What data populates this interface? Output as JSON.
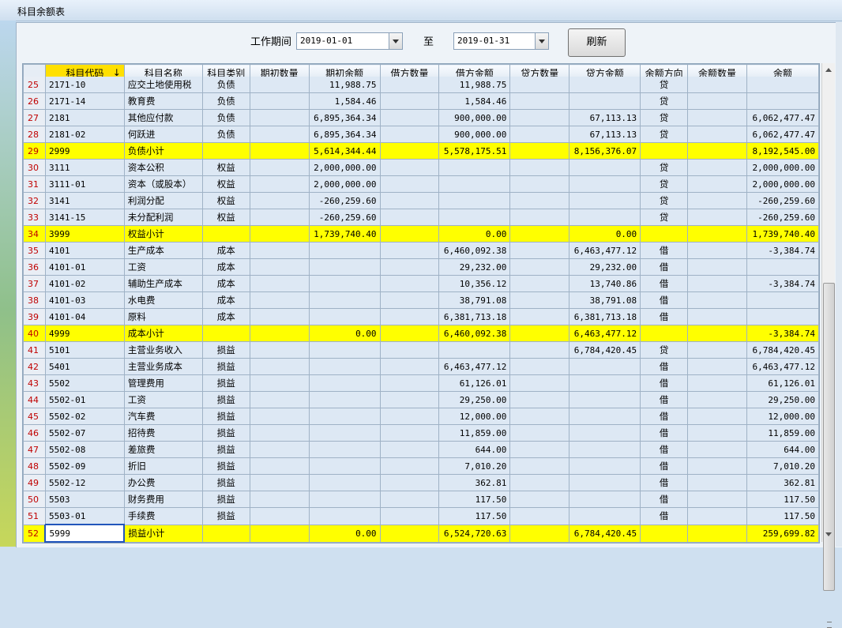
{
  "window": {
    "title": "科目余额表"
  },
  "toolbar": {
    "period_label": "工作期间",
    "start_date": "2019-01-01",
    "to_label": "至",
    "end_date": "2019-01-31",
    "refresh_label": "刷新"
  },
  "table": {
    "headers": [
      "科目代码",
      "科目名称",
      "科目类别",
      "期初数量",
      "期初余额",
      "借方数量",
      "借方金额",
      "贷方数量",
      "贷方金额",
      "余额方向",
      "余额数量",
      "余额"
    ],
    "sort_indicator": "↓",
    "rows": [
      {
        "no": "25",
        "code": "2171-10",
        "name": "应交土地使用税",
        "cat": "负债",
        "oq": "",
        "ob": "11,988.75",
        "dq": "",
        "da": "11,988.75",
        "cq": "",
        "ca": "",
        "dir": "贷",
        "bq": "",
        "bal": "",
        "subtotal": false
      },
      {
        "no": "26",
        "code": "2171-14",
        "name": "教育费",
        "cat": "负债",
        "oq": "",
        "ob": "1,584.46",
        "dq": "",
        "da": "1,584.46",
        "cq": "",
        "ca": "",
        "dir": "贷",
        "bq": "",
        "bal": "",
        "subtotal": false
      },
      {
        "no": "27",
        "code": "2181",
        "name": "其他应付款",
        "cat": "负债",
        "oq": "",
        "ob": "6,895,364.34",
        "dq": "",
        "da": "900,000.00",
        "cq": "",
        "ca": "67,113.13",
        "dir": "贷",
        "bq": "",
        "bal": "6,062,477.47",
        "subtotal": false
      },
      {
        "no": "28",
        "code": "2181-02",
        "name": "何跃进",
        "cat": "负债",
        "oq": "",
        "ob": "6,895,364.34",
        "dq": "",
        "da": "900,000.00",
        "cq": "",
        "ca": "67,113.13",
        "dir": "贷",
        "bq": "",
        "bal": "6,062,477.47",
        "subtotal": false
      },
      {
        "no": "29",
        "code": "2999",
        "name": "负债小计",
        "cat": "",
        "oq": "",
        "ob": "5,614,344.44",
        "dq": "",
        "da": "5,578,175.51",
        "cq": "",
        "ca": "8,156,376.07",
        "dir": "",
        "bq": "",
        "bal": "8,192,545.00",
        "subtotal": true
      },
      {
        "no": "30",
        "code": "3111",
        "name": "资本公积",
        "cat": "权益",
        "oq": "",
        "ob": "2,000,000.00",
        "dq": "",
        "da": "",
        "cq": "",
        "ca": "",
        "dir": "贷",
        "bq": "",
        "bal": "2,000,000.00",
        "subtotal": false
      },
      {
        "no": "31",
        "code": "3111-01",
        "name": "资本（或股本）",
        "cat": "权益",
        "oq": "",
        "ob": "2,000,000.00",
        "dq": "",
        "da": "",
        "cq": "",
        "ca": "",
        "dir": "贷",
        "bq": "",
        "bal": "2,000,000.00",
        "subtotal": false
      },
      {
        "no": "32",
        "code": "3141",
        "name": "利润分配",
        "cat": "权益",
        "oq": "",
        "ob": "-260,259.60",
        "dq": "",
        "da": "",
        "cq": "",
        "ca": "",
        "dir": "贷",
        "bq": "",
        "bal": "-260,259.60",
        "subtotal": false
      },
      {
        "no": "33",
        "code": "3141-15",
        "name": "未分配利润",
        "cat": "权益",
        "oq": "",
        "ob": "-260,259.60",
        "dq": "",
        "da": "",
        "cq": "",
        "ca": "",
        "dir": "贷",
        "bq": "",
        "bal": "-260,259.60",
        "subtotal": false
      },
      {
        "no": "34",
        "code": "3999",
        "name": "权益小计",
        "cat": "",
        "oq": "",
        "ob": "1,739,740.40",
        "dq": "",
        "da": "0.00",
        "cq": "",
        "ca": "0.00",
        "dir": "",
        "bq": "",
        "bal": "1,739,740.40",
        "subtotal": true
      },
      {
        "no": "35",
        "code": "4101",
        "name": "生产成本",
        "cat": "成本",
        "oq": "",
        "ob": "",
        "dq": "",
        "da": "6,460,092.38",
        "cq": "",
        "ca": "6,463,477.12",
        "dir": "借",
        "bq": "",
        "bal": "-3,384.74",
        "subtotal": false
      },
      {
        "no": "36",
        "code": "4101-01",
        "name": "工资",
        "cat": "成本",
        "oq": "",
        "ob": "",
        "dq": "",
        "da": "29,232.00",
        "cq": "",
        "ca": "29,232.00",
        "dir": "借",
        "bq": "",
        "bal": "",
        "subtotal": false
      },
      {
        "no": "37",
        "code": "4101-02",
        "name": "辅助生产成本",
        "cat": "成本",
        "oq": "",
        "ob": "",
        "dq": "",
        "da": "10,356.12",
        "cq": "",
        "ca": "13,740.86",
        "dir": "借",
        "bq": "",
        "bal": "-3,384.74",
        "subtotal": false
      },
      {
        "no": "38",
        "code": "4101-03",
        "name": "水电费",
        "cat": "成本",
        "oq": "",
        "ob": "",
        "dq": "",
        "da": "38,791.08",
        "cq": "",
        "ca": "38,791.08",
        "dir": "借",
        "bq": "",
        "bal": "",
        "subtotal": false
      },
      {
        "no": "39",
        "code": "4101-04",
        "name": "原料",
        "cat": "成本",
        "oq": "",
        "ob": "",
        "dq": "",
        "da": "6,381,713.18",
        "cq": "",
        "ca": "6,381,713.18",
        "dir": "借",
        "bq": "",
        "bal": "",
        "subtotal": false
      },
      {
        "no": "40",
        "code": "4999",
        "name": "成本小计",
        "cat": "",
        "oq": "",
        "ob": "0.00",
        "dq": "",
        "da": "6,460,092.38",
        "cq": "",
        "ca": "6,463,477.12",
        "dir": "",
        "bq": "",
        "bal": "-3,384.74",
        "subtotal": true
      },
      {
        "no": "41",
        "code": "5101",
        "name": "主营业务收入",
        "cat": "损益",
        "oq": "",
        "ob": "",
        "dq": "",
        "da": "",
        "cq": "",
        "ca": "6,784,420.45",
        "dir": "贷",
        "bq": "",
        "bal": "6,784,420.45",
        "subtotal": false
      },
      {
        "no": "42",
        "code": "5401",
        "name": "主营业务成本",
        "cat": "损益",
        "oq": "",
        "ob": "",
        "dq": "",
        "da": "6,463,477.12",
        "cq": "",
        "ca": "",
        "dir": "借",
        "bq": "",
        "bal": "6,463,477.12",
        "subtotal": false
      },
      {
        "no": "43",
        "code": "5502",
        "name": "管理费用",
        "cat": "损益",
        "oq": "",
        "ob": "",
        "dq": "",
        "da": "61,126.01",
        "cq": "",
        "ca": "",
        "dir": "借",
        "bq": "",
        "bal": "61,126.01",
        "subtotal": false
      },
      {
        "no": "44",
        "code": "5502-01",
        "name": "工资",
        "cat": "损益",
        "oq": "",
        "ob": "",
        "dq": "",
        "da": "29,250.00",
        "cq": "",
        "ca": "",
        "dir": "借",
        "bq": "",
        "bal": "29,250.00",
        "subtotal": false
      },
      {
        "no": "45",
        "code": "5502-02",
        "name": "汽车费",
        "cat": "损益",
        "oq": "",
        "ob": "",
        "dq": "",
        "da": "12,000.00",
        "cq": "",
        "ca": "",
        "dir": "借",
        "bq": "",
        "bal": "12,000.00",
        "subtotal": false
      },
      {
        "no": "46",
        "code": "5502-07",
        "name": "招待费",
        "cat": "损益",
        "oq": "",
        "ob": "",
        "dq": "",
        "da": "11,859.00",
        "cq": "",
        "ca": "",
        "dir": "借",
        "bq": "",
        "bal": "11,859.00",
        "subtotal": false
      },
      {
        "no": "47",
        "code": "5502-08",
        "name": "差旅费",
        "cat": "损益",
        "oq": "",
        "ob": "",
        "dq": "",
        "da": "644.00",
        "cq": "",
        "ca": "",
        "dir": "借",
        "bq": "",
        "bal": "644.00",
        "subtotal": false
      },
      {
        "no": "48",
        "code": "5502-09",
        "name": "折旧",
        "cat": "损益",
        "oq": "",
        "ob": "",
        "dq": "",
        "da": "7,010.20",
        "cq": "",
        "ca": "",
        "dir": "借",
        "bq": "",
        "bal": "7,010.20",
        "subtotal": false
      },
      {
        "no": "49",
        "code": "5502-12",
        "name": "办公费",
        "cat": "损益",
        "oq": "",
        "ob": "",
        "dq": "",
        "da": "362.81",
        "cq": "",
        "ca": "",
        "dir": "借",
        "bq": "",
        "bal": "362.81",
        "subtotal": false
      },
      {
        "no": "50",
        "code": "5503",
        "name": "财务费用",
        "cat": "损益",
        "oq": "",
        "ob": "",
        "dq": "",
        "da": "117.50",
        "cq": "",
        "ca": "",
        "dir": "借",
        "bq": "",
        "bal": "117.50",
        "subtotal": false
      },
      {
        "no": "51",
        "code": "5503-01",
        "name": "手续费",
        "cat": "损益",
        "oq": "",
        "ob": "",
        "dq": "",
        "da": "117.50",
        "cq": "",
        "ca": "",
        "dir": "借",
        "bq": "",
        "bal": "117.50",
        "subtotal": false
      },
      {
        "no": "52",
        "code": "5999",
        "name": "损益小计",
        "cat": "",
        "oq": "",
        "ob": "0.00",
        "dq": "",
        "da": "6,524,720.63",
        "cq": "",
        "ca": "6,784,420.45",
        "dir": "",
        "bq": "",
        "bal": "259,699.82",
        "subtotal": true
      }
    ]
  }
}
